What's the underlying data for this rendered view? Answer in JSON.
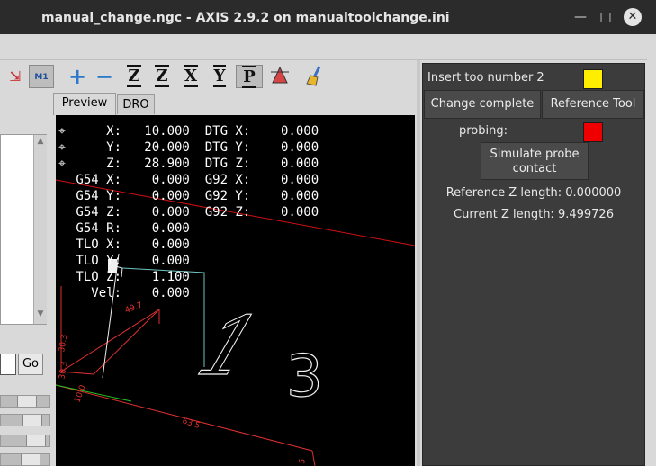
{
  "window": {
    "title": "manual_change.ngc - AXIS 2.9.2 on manualtoolchange.ini",
    "minimize_icon": "minimize-icon",
    "maximize_icon": "maximize-icon",
    "close_icon": "close-icon"
  },
  "toolbar": {
    "buttons": [
      {
        "name": "edit-toggle-icon",
        "label": ""
      },
      {
        "name": "optional-stop-icon",
        "label": "M1"
      },
      {
        "name": "zoom-in-icon",
        "label": "+"
      },
      {
        "name": "zoom-out-icon",
        "label": "−"
      },
      {
        "name": "view-z-icon",
        "label": "Z"
      },
      {
        "name": "view-rotated-z-icon",
        "label": "Z"
      },
      {
        "name": "view-x-icon",
        "label": "X"
      },
      {
        "name": "view-y-icon",
        "label": "Y"
      },
      {
        "name": "view-perspective-icon",
        "label": "P"
      },
      {
        "name": "toggle-tool-icon",
        "label": ""
      },
      {
        "name": "clear-backplot-icon",
        "label": ""
      }
    ]
  },
  "left": {
    "go_label": "Go"
  },
  "tabs": [
    {
      "label": "Preview"
    },
    {
      "label": "DRO"
    }
  ],
  "dro": {
    "rows": [
      {
        "marker": true,
        "text": "     X:   10.000  DTG X:    0.000"
      },
      {
        "marker": true,
        "text": "     Y:   20.000  DTG Y:    0.000"
      },
      {
        "marker": true,
        "text": "     Z:   28.900  DTG Z:    0.000"
      },
      {
        "marker": false,
        "text": " G54 X:    0.000  G92 X:    0.000"
      },
      {
        "marker": false,
        "text": " G54 Y:    0.000  G92 Y:    0.000"
      },
      {
        "marker": false,
        "text": " G54 Z:    0.000  G92 Z:    0.000"
      },
      {
        "marker": false,
        "text": " G54 R:    0.000"
      },
      {
        "marker": false,
        "text": " TLO X:    0.000"
      },
      {
        "marker": false,
        "text": " TLO Y:    0.000"
      },
      {
        "marker": false,
        "text": " TLO Z:    1.100"
      },
      {
        "marker": false,
        "text": "   Vel:    0.000"
      }
    ]
  },
  "preview": {
    "dim_labels": [
      "30.3",
      "30.3",
      "49.7",
      "63.5",
      "10.0",
      "5"
    ],
    "glyph_labels": [
      "1",
      "3"
    ]
  },
  "panel": {
    "insert_tool_label": "Insert too number 2",
    "insert_indicator_color": "#ffee00",
    "change_complete_label": "Change complete",
    "reference_tool_label": "Reference Tool",
    "probing_label": "probing:",
    "probing_indicator_color": "#ee0000",
    "simulate_probe_label": "Simulate probe contact",
    "reference_z_label": "Reference Z length: 0.000000",
    "current_z_label": "Current Z length: 9.499726"
  }
}
